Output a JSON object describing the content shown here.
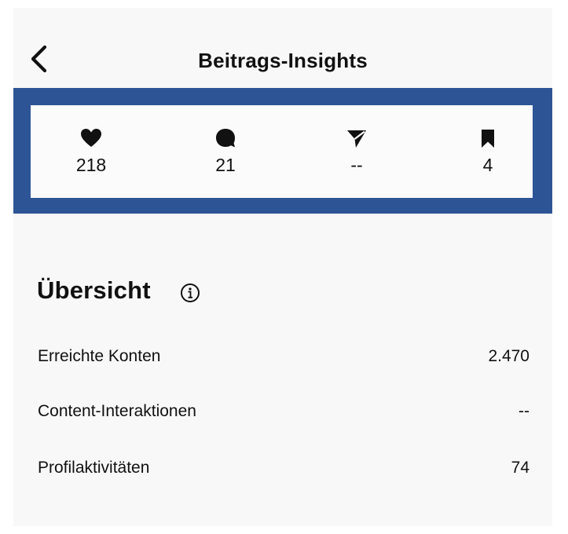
{
  "header": {
    "title": "Beitrags-Insights",
    "back_icon": "chevron-left-icon"
  },
  "stats": {
    "frame_color": "#2d5595",
    "items": [
      {
        "icon": "heart-icon",
        "value": "218"
      },
      {
        "icon": "comment-icon",
        "value": "21"
      },
      {
        "icon": "send-icon",
        "value": "--"
      },
      {
        "icon": "bookmark-icon",
        "value": "4"
      }
    ]
  },
  "overview": {
    "title": "Übersicht",
    "info_icon": "info-icon",
    "rows": [
      {
        "label": "Erreichte Konten",
        "value": "2.470"
      },
      {
        "label": "Content-Interaktionen",
        "value": "--"
      },
      {
        "label": "Profilaktivitäten",
        "value": "74"
      }
    ]
  }
}
